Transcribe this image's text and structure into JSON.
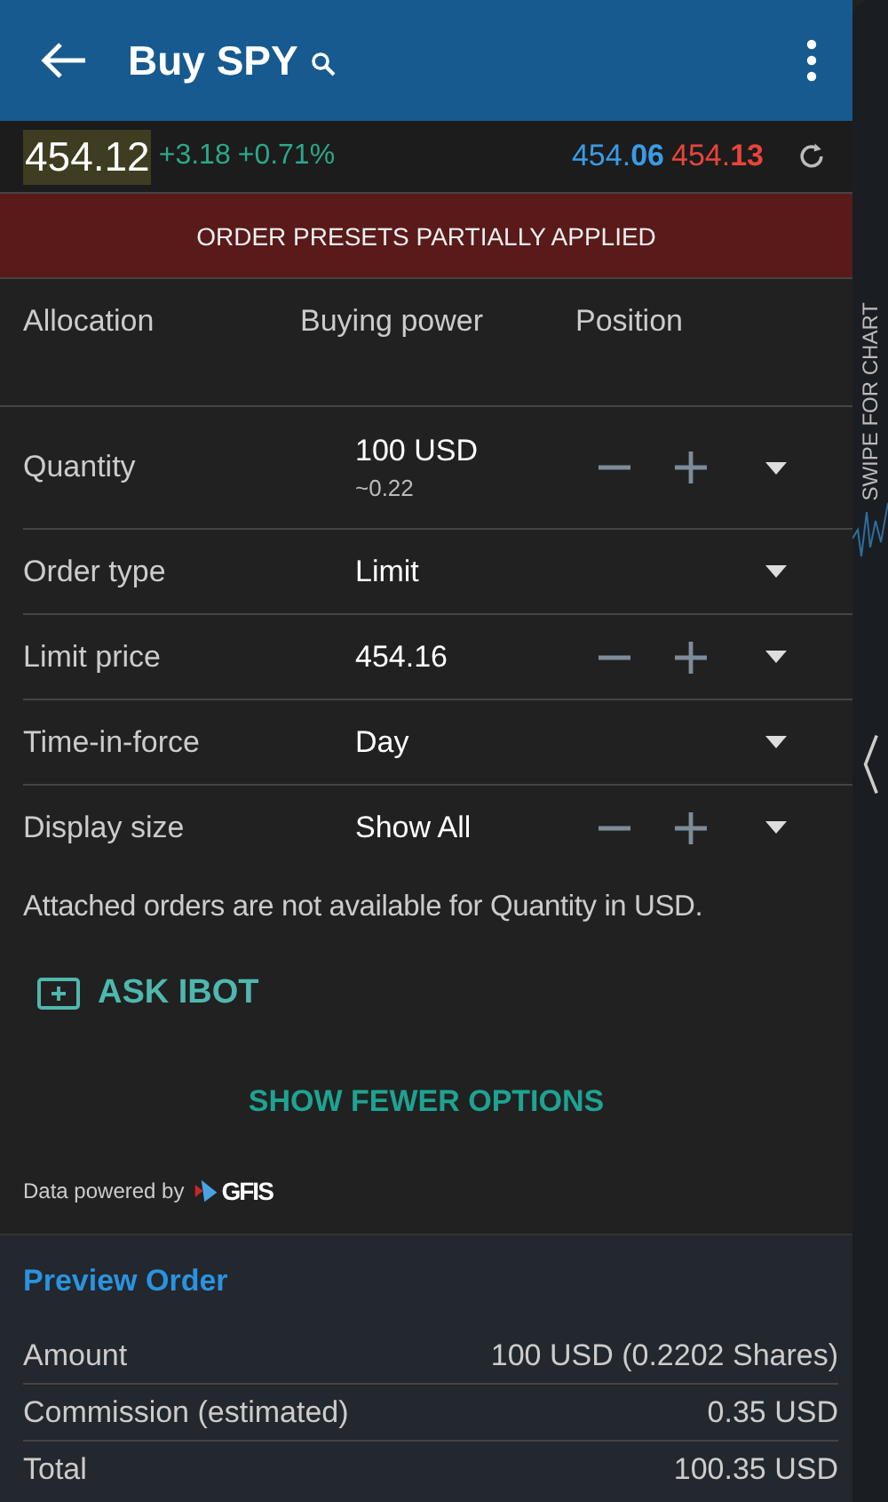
{
  "header": {
    "title": "Buy SPY"
  },
  "quote": {
    "last": "454.12",
    "change": "+3.18",
    "change_pct": "+0.71%",
    "bid": "454.**06**",
    "ask": "454.**13**"
  },
  "banner": "ORDER PRESETS PARTIALLY APPLIED",
  "tabs": [
    "Allocation",
    "Buying power",
    "Position"
  ],
  "fields": [
    {
      "label": "Quantity",
      "value": "100 USD",
      "sub": "~0.22",
      "stepper": true
    },
    {
      "label": "Order type",
      "value": "Limit",
      "stepper": false
    },
    {
      "label": "Limit price",
      "value": "454.16",
      "stepper": true
    },
    {
      "label": "Time-in-force",
      "value": "Day",
      "stepper": false
    },
    {
      "label": "Display size",
      "value": "Show All",
      "stepper": true
    }
  ],
  "note": "Attached orders are not available for Quantity in USD.",
  "ask_button": "ASK IBOT",
  "toggle_options": "SHOW FEWER OPTIONS",
  "powered_by": {
    "text": "Data powered by",
    "brand": "GFIS"
  },
  "preview": {
    "title": "Preview Order",
    "rows": [
      {
        "label": "Amount",
        "value": "100 USD (0.2202 Shares)"
      },
      {
        "label": "Commission (estimated)",
        "value": "0.35 USD"
      },
      {
        "label": "Total",
        "value": "100.35 USD"
      }
    ]
  },
  "side_tab": "SWIPE FOR CHART"
}
